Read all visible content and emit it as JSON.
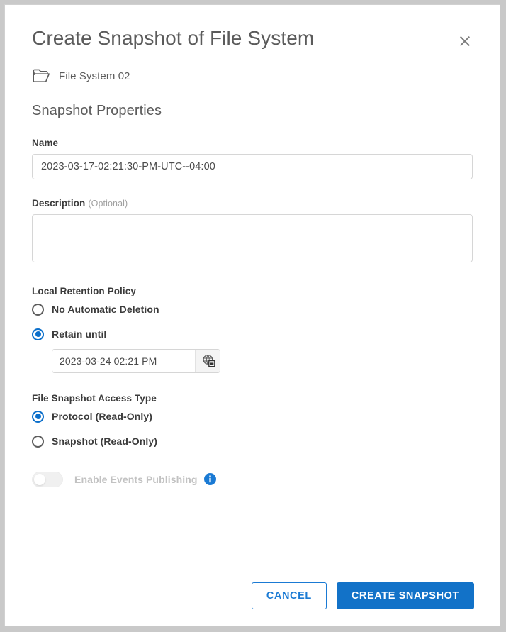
{
  "dialog": {
    "title": "Create Snapshot of File System",
    "close_icon": "close-icon",
    "file_system": {
      "icon": "folder-icon",
      "name": "File System 02"
    },
    "section_heading": "Snapshot Properties",
    "fields": {
      "name": {
        "label": "Name",
        "value": "2023-03-17-02:21:30-PM-UTC--04:00",
        "placeholder": ""
      },
      "description": {
        "label": "Description",
        "optional_suffix": "(Optional)",
        "value": "",
        "placeholder": ""
      }
    },
    "local_retention_policy": {
      "heading": "Local Retention Policy",
      "options": [
        {
          "label": "No Automatic Deletion",
          "selected": false
        },
        {
          "label": "Retain until",
          "selected": true
        }
      ],
      "retain_until": {
        "value": "2023-03-24 02:21 PM",
        "placeholder": "",
        "picker_icon": "calendar-clock-icon"
      }
    },
    "file_snapshot_access_type": {
      "heading": "File Snapshot Access Type",
      "options": [
        {
          "label": "Protocol (Read-Only)",
          "selected": true
        },
        {
          "label": "Snapshot (Read-Only)",
          "selected": false
        }
      ]
    },
    "events_publishing": {
      "label": "Enable Events Publishing",
      "enabled": false,
      "disabled": true,
      "info_icon": "info-icon"
    },
    "footer": {
      "cancel_label": "CANCEL",
      "submit_label": "CREATE SNAPSHOT"
    },
    "colors": {
      "accent_blue": "#1272c8",
      "link_blue": "#1a7ad4",
      "radio_blue": "#0b6fcb",
      "info_blue": "#1a7ad4",
      "text_dark": "#3b3b3b",
      "text_muted": "#5b5b5b",
      "text_disabled": "#c2c2c2",
      "border": "#d6d6d6"
    }
  }
}
